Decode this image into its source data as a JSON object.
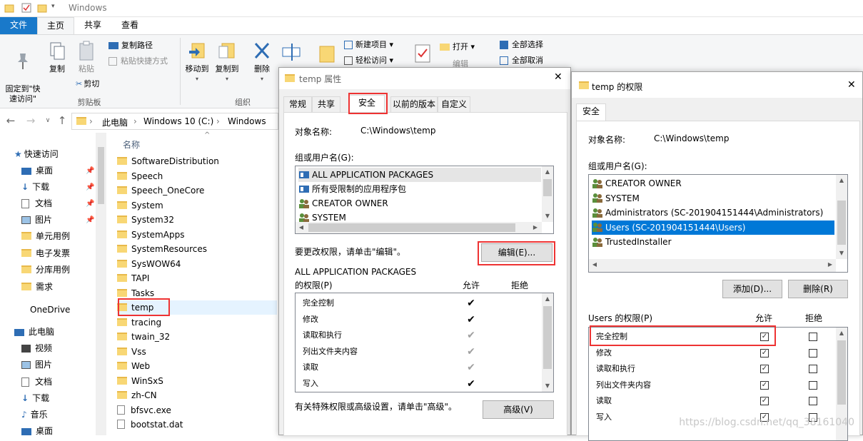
{
  "explorer": {
    "title": "Windows",
    "ribbon_tabs": {
      "file": "文件",
      "home": "主页",
      "share": "共享",
      "view": "查看"
    },
    "ribbon": {
      "pin_quick": "固定到\"快\n速访问\"",
      "copy": "复制",
      "paste": "粘贴",
      "copy_path": "复制路径",
      "paste_shortcut": "粘贴快捷方式",
      "cut": "剪切",
      "clipboard_group": "剪贴板",
      "move_to": "移动到",
      "copy_to": "复制到",
      "delete": "删除",
      "organize_group": "组织",
      "new_item": "新建项目",
      "easy_access": "轻松访问",
      "open": "打开",
      "edit": "编辑",
      "select_all": "全部选择",
      "select_none": "全部取消"
    },
    "address": {
      "this_pc": "此电脑",
      "drive": "Windows 10 (C:)",
      "folder": "Windows"
    },
    "nav": {
      "quick_access": "快速访问",
      "desktop": "桌面",
      "downloads": "下载",
      "documents": "文档",
      "pictures": "图片",
      "folder1": "单元用例",
      "folder2": "电子发票",
      "folder3": "分库用例",
      "folder4": "需求",
      "onedrive": "OneDrive",
      "this_pc": "此电脑",
      "videos": "视频",
      "pictures2": "图片",
      "documents2": "文档",
      "downloads2": "下载",
      "music": "音乐",
      "desktop2": "桌面"
    },
    "list_header": "名称",
    "files": [
      "SoftwareDistribution",
      "Speech",
      "Speech_OneCore",
      "System",
      "System32",
      "SystemApps",
      "SystemResources",
      "SysWOW64",
      "TAPI",
      "Tasks",
      "temp",
      "tracing",
      "twain_32",
      "Vss",
      "Web",
      "WinSxS",
      "zh-CN",
      "bfsvc.exe",
      "bootstat.dat"
    ]
  },
  "props": {
    "title": "temp 属性",
    "tabs": [
      "常规",
      "共享",
      "安全",
      "以前的版本",
      "自定义"
    ],
    "object_label": "对象名称:",
    "object_value": "C:\\Windows\\temp",
    "group_label": "组或用户名(G):",
    "users": [
      "ALL APPLICATION PACKAGES",
      "所有受限制的应用程序包",
      "CREATOR OWNER",
      "SYSTEM"
    ],
    "change_hint": "要更改权限，请单击\"编辑\"。",
    "edit_button": "编辑(E)...",
    "perm_for_line1": "ALL APPLICATION PACKAGES",
    "perm_for_line2": "的权限(P)",
    "allow": "允许",
    "deny": "拒绝",
    "perms": [
      "完全控制",
      "修改",
      "读取和执行",
      "列出文件夹内容",
      "读取",
      "写入"
    ],
    "perm_allow": [
      "✔",
      "✔",
      "✔",
      "✔",
      "✔",
      "✔"
    ],
    "advanced_hint": "有关特殊权限或高级设置，请单击\"高级\"。",
    "advanced_button": "高级(V)"
  },
  "perm_dialog": {
    "title": "temp 的权限",
    "tab": "安全",
    "object_label": "对象名称:",
    "object_value": "C:\\Windows\\temp",
    "group_label": "组或用户名(G):",
    "users": [
      "CREATOR OWNER",
      "SYSTEM",
      "Administrators (SC-201904151444\\Administrators)",
      "Users (SC-201904151444\\Users)",
      "TrustedInstaller"
    ],
    "add_button": "添加(D)...",
    "remove_button": "删除(R)",
    "perm_for": "Users 的权限(P)",
    "allow": "允许",
    "deny": "拒绝",
    "perms": [
      "完全控制",
      "修改",
      "读取和执行",
      "列出文件夹内容",
      "读取",
      "写入"
    ],
    "check": "✓"
  },
  "watermark": "https://blog.csdn.net/qq_38161040"
}
